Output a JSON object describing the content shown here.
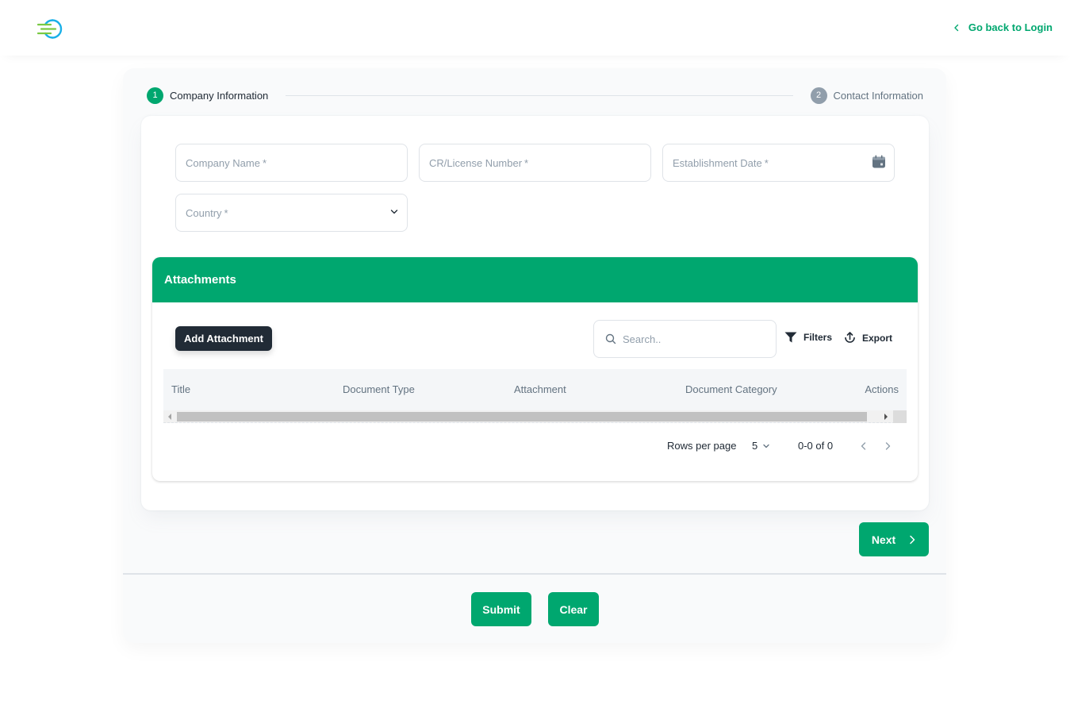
{
  "header": {
    "back_link": "Go back to Login",
    "colors": {
      "accent": "#00a76f",
      "logo_blue": "#1ab0e8",
      "logo_green": "#7ac943"
    }
  },
  "stepper": {
    "steps": [
      {
        "number": "1",
        "label": "Company Information",
        "state": "active"
      },
      {
        "number": "2",
        "label": "Contact Information",
        "state": "inactive"
      }
    ]
  },
  "form": {
    "company_name": {
      "placeholder": "Company Name",
      "required": "*"
    },
    "license_number": {
      "placeholder": "CR/License Number",
      "required": "*"
    },
    "establishment_date": {
      "placeholder": "Establishment Date",
      "required": "*",
      "icon": "calendar-icon"
    },
    "country": {
      "placeholder": "Country",
      "required": "*",
      "icon": "chevron-down-icon"
    }
  },
  "attachments": {
    "title": "Attachments",
    "add_button": "Add Attachment",
    "search_placeholder": "Search..",
    "filters_label": "Filters",
    "export_label": "Export",
    "columns": [
      "Title",
      "Document Type",
      "Attachment",
      "Document Category",
      "Actions"
    ],
    "rows": [],
    "pagination": {
      "rows_per_page_label": "Rows per page",
      "rows_per_page_value": "5",
      "range": "0-0 of 0"
    }
  },
  "actions": {
    "next": "Next",
    "submit": "Submit",
    "clear": "Clear"
  }
}
